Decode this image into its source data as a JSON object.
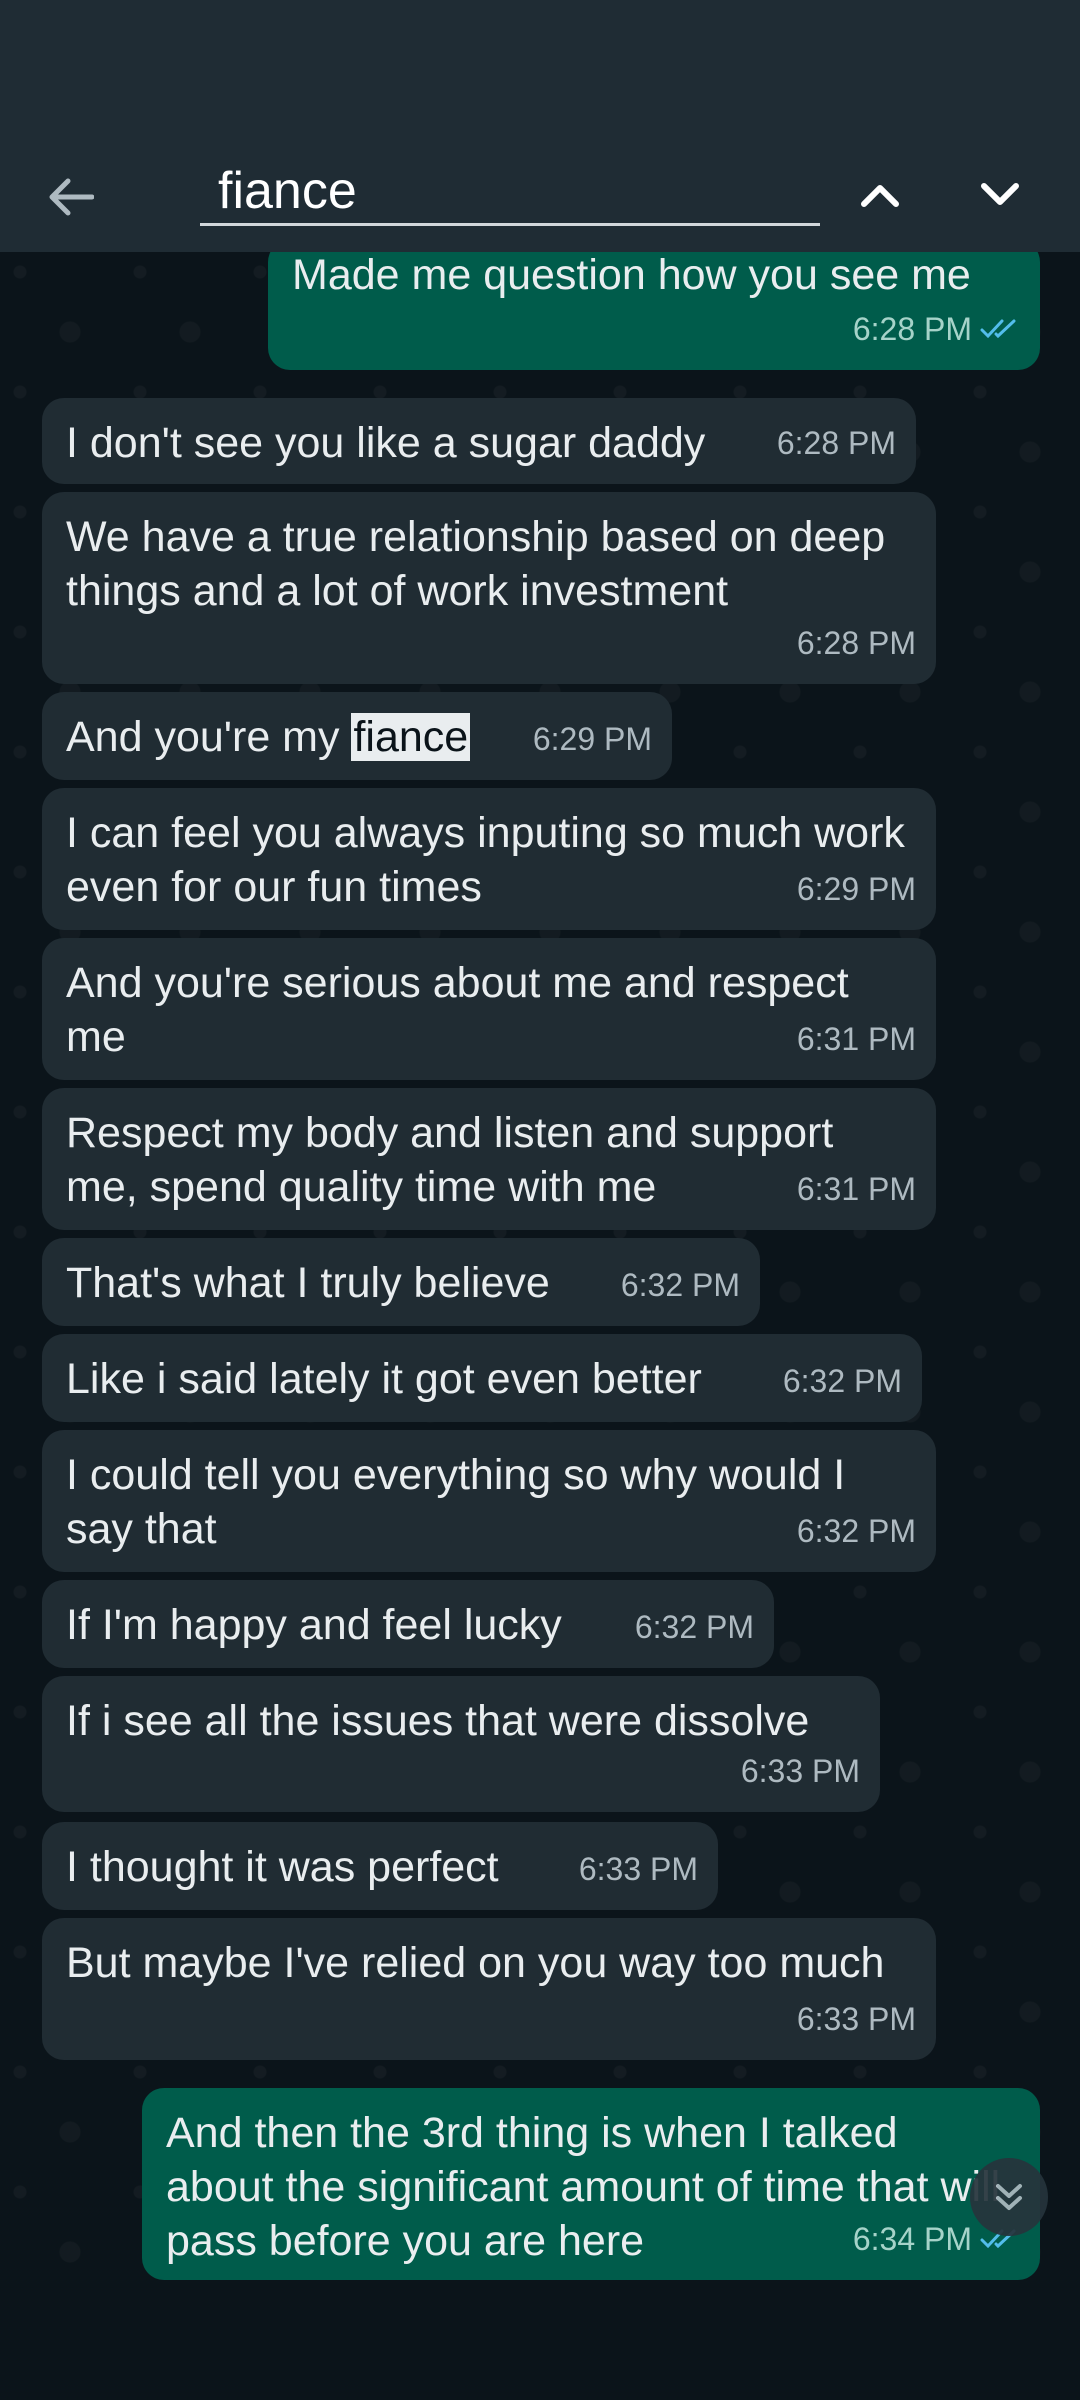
{
  "search": {
    "query": "fiance"
  },
  "colors": {
    "incoming_bubble": "#202c33",
    "outgoing_bubble": "#005c4b",
    "read_tick": "#53bdeb"
  },
  "messages": [
    {
      "dir": "out",
      "text": "Made me question how you see me",
      "time": "6:28 PM"
    },
    {
      "dir": "in",
      "text": "I don't see you like a sugar daddy",
      "time": "6:28 PM"
    },
    {
      "dir": "in",
      "text": "We have a true relationship based on deep things and a lot of work investment",
      "time": "6:28 PM"
    },
    {
      "dir": "in",
      "text_before": "And you're my ",
      "highlight": "fiance",
      "time": "6:29 PM"
    },
    {
      "dir": "in",
      "text": "I can feel you always inputing so much work even for our fun times",
      "time": "6:29 PM"
    },
    {
      "dir": "in",
      "text": "And you're serious about me and respect me",
      "time": "6:31 PM"
    },
    {
      "dir": "in",
      "text": "Respect my body and listen and support me, spend quality time with me",
      "time": "6:31 PM"
    },
    {
      "dir": "in",
      "text": "That's what I truly believe",
      "time": "6:32 PM"
    },
    {
      "dir": "in",
      "text": "Like i said lately it got even better",
      "time": "6:32 PM"
    },
    {
      "dir": "in",
      "text": "I could tell you everything so why would I say that",
      "time": "6:32 PM"
    },
    {
      "dir": "in",
      "text": "If I'm happy and feel lucky",
      "time": "6:32 PM"
    },
    {
      "dir": "in",
      "text": "If i see all the issues that were dissolve",
      "time": "6:33 PM"
    },
    {
      "dir": "in",
      "text": "I thought it was perfect",
      "time": "6:33 PM"
    },
    {
      "dir": "in",
      "text": "But maybe I've relied on you way too much",
      "time": "6:33 PM"
    },
    {
      "dir": "out",
      "text": "And then the 3rd thing is when I talked about the significant amount of time that will pass before you are here",
      "time": "6:34 PM"
    }
  ],
  "icons": {
    "back": "arrow-left-icon",
    "up": "chevron-up-icon",
    "down": "chevron-down-icon",
    "read": "double-check-icon",
    "scroll": "double-chevron-down-icon"
  }
}
